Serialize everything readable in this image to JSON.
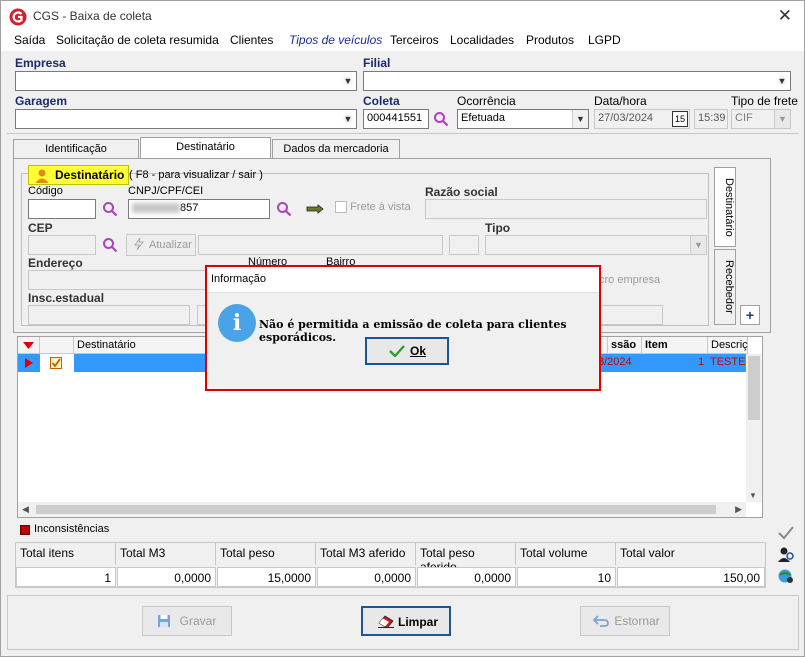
{
  "window": {
    "title": "CGS - Baixa de coleta",
    "close_glyph": "✕"
  },
  "menu": [
    "Saída",
    "Solicitação de coleta resumida",
    "Clientes",
    "Tipos de veículos",
    "Terceiros",
    "Localidades",
    "Produtos",
    "LGPD"
  ],
  "form": {
    "empresa_label": "Empresa",
    "filial_label": "Filial",
    "garagem_label": "Garagem",
    "coleta_label": "Coleta",
    "coleta_value": "000441551",
    "ocorrencia_label": "Ocorrência",
    "ocorrencia_value": "Efetuada",
    "datahora_label": "Data/hora",
    "data_value": "27/03/2024",
    "hora_value": "15:39",
    "date_btn": "15",
    "tipo_frete_label": "Tipo de frete",
    "tipo_frete_value": "CIF"
  },
  "tabs": [
    "Identificação",
    "Destinatário",
    "Dados da mercadoria"
  ],
  "destinatario": {
    "group_label": "Destinatário",
    "hint": "( F8 - para visualizar / sair )",
    "codigo_label": "Código",
    "cnpj_label": "CNPJ/CPF/CEI",
    "cnpj_value": "857",
    "frete_vista_label": "Frete à vista",
    "razao_label": "Razão social",
    "cep_label": "CEP",
    "atualizar_label": "Atualizar",
    "tipo_label": "Tipo",
    "endereco_label": "Endereço",
    "numero_label": "Número",
    "bairro_label": "Bairro",
    "micro_empresa_label": "cro empresa",
    "insc_label": "Insc.estadual"
  },
  "side_tabs": [
    "Destinatário",
    "Recebedor"
  ],
  "plus": "+",
  "grid": {
    "headers": [
      "Destinatário",
      "ssão",
      "Item",
      "Descriç"
    ],
    "row": {
      "date": "3/2024",
      "item": "1",
      "desc": "TESTE"
    }
  },
  "inconsistencias_label": "Inconsistências",
  "totals": {
    "headers": [
      "Total itens",
      "Total M3",
      "Total peso",
      "Total M3 aferido",
      "Total peso aferido",
      "Total volume",
      "Total valor"
    ],
    "values": [
      "1",
      "0,0000",
      "15,0000",
      "0,0000",
      "0,0000",
      "10",
      "150,00"
    ]
  },
  "buttons": {
    "gravar": "Gravar",
    "limpar": "Limpar",
    "estornar": "Estornar"
  },
  "dialog": {
    "title": "Informação",
    "message": "Não é permitida a emissão de coleta para clientes esporádicos.",
    "ok": "Ok",
    "info_glyph": "i"
  },
  "colors": {
    "accent": "#1c5597",
    "highlight": "#3399ff",
    "warn": "#e00000",
    "label": "#1a2a6c"
  }
}
